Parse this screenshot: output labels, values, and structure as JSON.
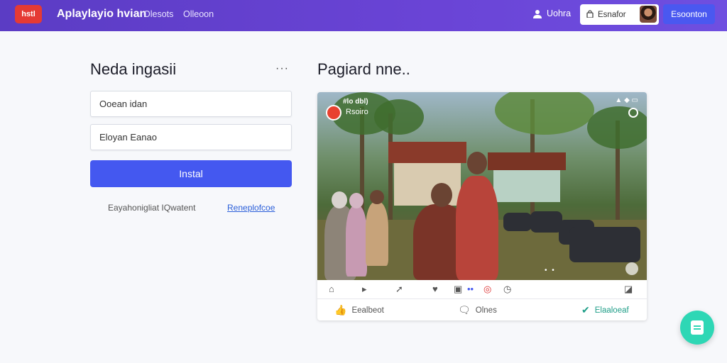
{
  "header": {
    "logo_text": "hstl",
    "brand": "Aplaylayio hvian",
    "nav": [
      "Olesots",
      "Olleoon"
    ],
    "user_link": "Uohra",
    "account_label": "Esnafor",
    "action_button": "Esoonton"
  },
  "login": {
    "title": "Neda ingasii",
    "more": "···",
    "field1_placeholder": "Ooean idan",
    "field2_placeholder": "Eloyan Eanao",
    "submit_label": "Instal",
    "helper_text": "Eayahonigliat IQwatent",
    "helper_link": "Reneplofcoe"
  },
  "post": {
    "title": "Pagiard nne..",
    "handle": "#lo dbl)",
    "subtitle": "Rsoiro",
    "dots": "• •",
    "actions": {
      "comment": "Eealbeot",
      "share": "Olnes",
      "save": "Elaaloeaf"
    }
  },
  "colors": {
    "header": "#5b3cc4",
    "primary": "#4458f0",
    "accent_green": "#2ed7b5",
    "logo_red": "#e53a34"
  }
}
